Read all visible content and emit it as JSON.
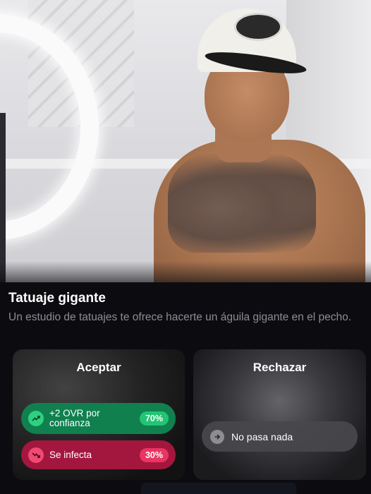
{
  "event": {
    "title": "Tatuaje gigante",
    "description": "Un estudio de tatuajes te ofrece hacerte un águila gigante en el pecho."
  },
  "choices": {
    "accept": {
      "label": "Aceptar",
      "outcomes": [
        {
          "icon": "trend-up-icon",
          "text": "+2 OVR por confianza",
          "percent": "70%",
          "color": "#10804f"
        },
        {
          "icon": "trend-down-icon",
          "text": "Se infecta",
          "percent": "30%",
          "color": "#a3173e"
        }
      ]
    },
    "reject": {
      "label": "Rechazar",
      "outcomes": [
        {
          "icon": "arrow-right-icon",
          "text": "No pasa nada"
        }
      ]
    }
  },
  "colors": {
    "positive": "#10804f",
    "positive_badge": "#21c574",
    "negative": "#a3173e",
    "negative_badge": "#ea3463",
    "neutral": "#48484c",
    "background": "#0c0c10"
  }
}
